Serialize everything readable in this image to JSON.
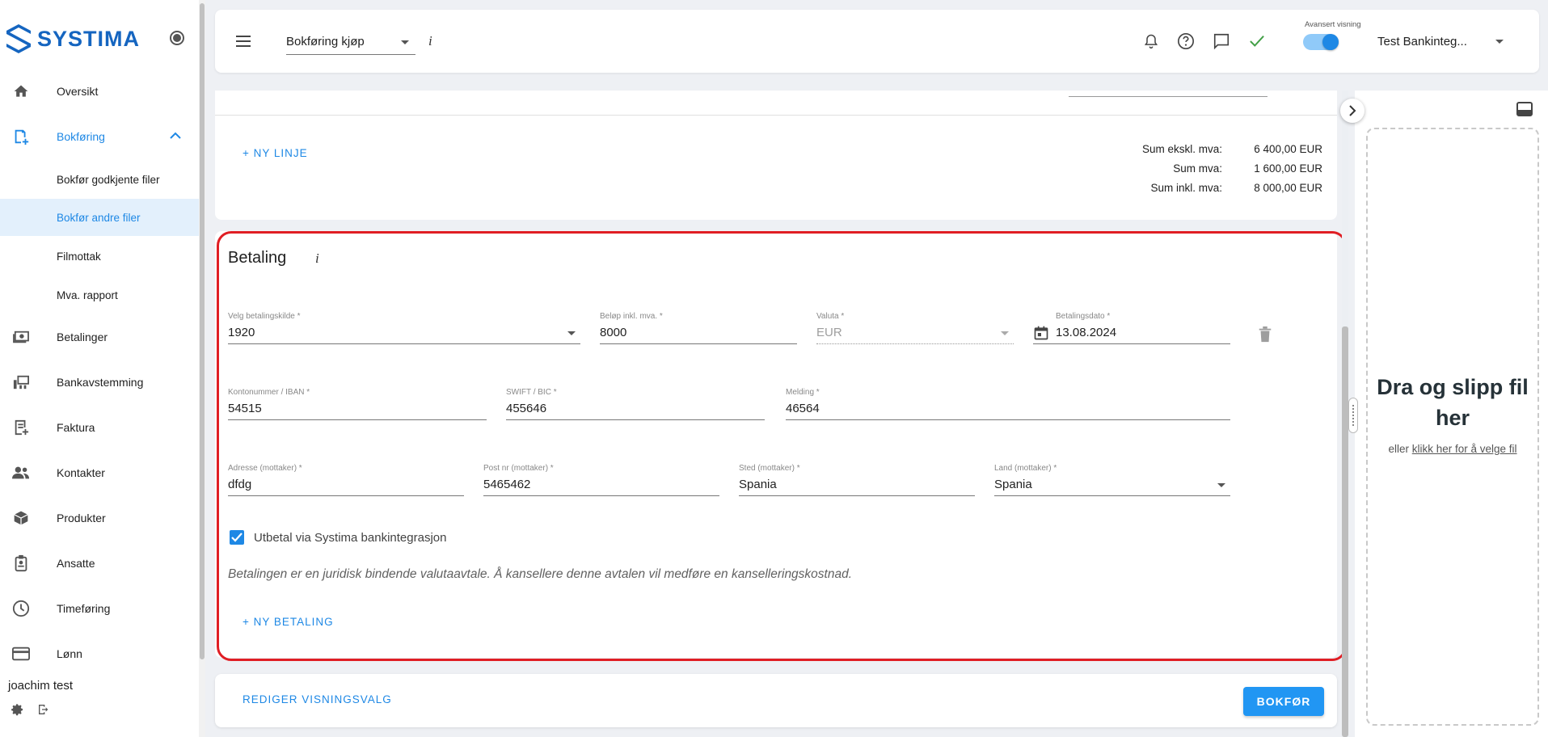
{
  "app": {
    "logo_text": "SYSTIMA"
  },
  "sidebar": {
    "items": [
      {
        "label": "Oversikt"
      },
      {
        "label": "Bokføring"
      },
      {
        "label": "Betalinger"
      },
      {
        "label": "Bankavstemming"
      },
      {
        "label": "Faktura"
      },
      {
        "label": "Kontakter"
      },
      {
        "label": "Produkter"
      },
      {
        "label": "Ansatte"
      },
      {
        "label": "Timeføring"
      },
      {
        "label": "Lønn"
      }
    ],
    "sub_items": [
      {
        "label": "Bokfør godkjente filer"
      },
      {
        "label": "Bokfør andre filer"
      },
      {
        "label": "Filmottak"
      },
      {
        "label": "Mva. rapport"
      }
    ],
    "user_name": "joachim test"
  },
  "topbar": {
    "page_select": "Bokføring kjøp",
    "info": "i",
    "advanced_view_label": "Avansert visning",
    "advanced_view_on": true,
    "company": "Test Bankinteg..."
  },
  "summary": {
    "new_line": "+ NY LINJE",
    "rows": [
      {
        "label": "Sum ekskl. mva:",
        "value": "6 400,00 EUR"
      },
      {
        "label": "Sum mva:",
        "value": "1 600,00 EUR"
      },
      {
        "label": "Sum inkl. mva:",
        "value": "8 000,00 EUR"
      }
    ]
  },
  "payment": {
    "title": "Betaling",
    "info": "i",
    "fields": {
      "source": {
        "label": "Velg betalingskilde *",
        "value": "1920"
      },
      "amount": {
        "label": "Beløp inkl. mva. *",
        "value": "8000"
      },
      "currency": {
        "label": "Valuta *",
        "value": "EUR"
      },
      "date": {
        "label": "Betalingsdato *",
        "value": "13.08.2024"
      },
      "account": {
        "label": "Kontonummer / IBAN *",
        "value": "54515"
      },
      "swift": {
        "label": "SWIFT / BIC *",
        "value": "455646"
      },
      "message": {
        "label": "Melding *",
        "value": "46564"
      },
      "address": {
        "label": "Adresse (mottaker) *",
        "value": "dfdg"
      },
      "postcode": {
        "label": "Post nr (mottaker) *",
        "value": "5465462"
      },
      "place": {
        "label": "Sted (mottaker) *",
        "value": "Spania"
      },
      "country": {
        "label": "Land (mottaker) *",
        "value": "Spania"
      }
    },
    "checkbox_label": "Utbetal via Systima bankintegrasjon",
    "checkbox_checked": true,
    "notice": "Betalingen er en juridisk bindende valutaavtale. Å kansellere denne avtalen vil medføre en kanselleringskostnad.",
    "new_payment": "+ NY BETALING"
  },
  "footer": {
    "edit_view": "REDIGER VISNINGSVALG",
    "book": "BOKFØR"
  },
  "dropzone": {
    "title": "Dra og slipp fil her",
    "or": "eller",
    "link": "klikk her for å velge fil"
  },
  "colors": {
    "accent": "#1e88e5",
    "highlight": "#e01e24",
    "success": "#43a047"
  }
}
